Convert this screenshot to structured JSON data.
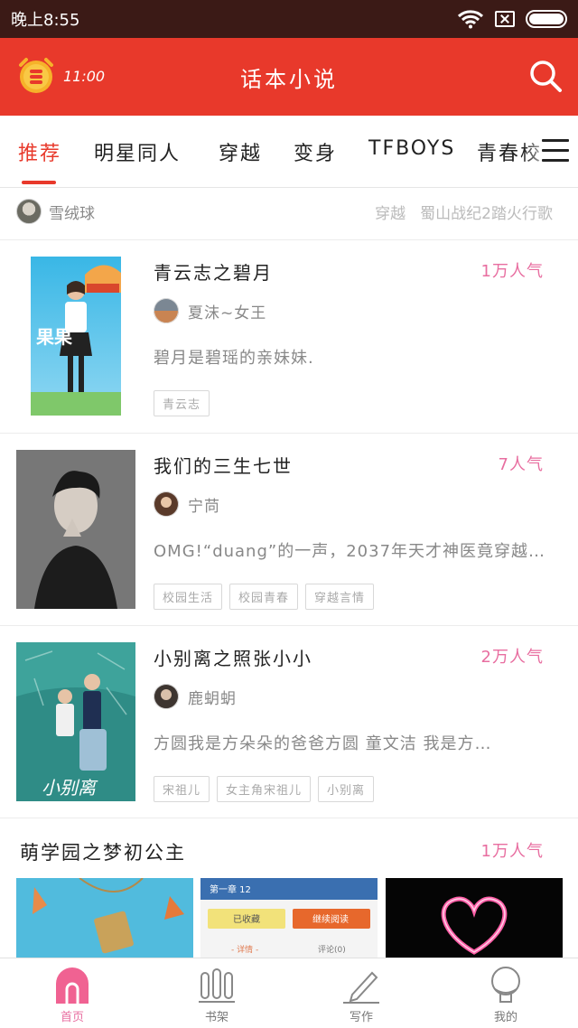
{
  "status_bar": {
    "time": "晚上8:55"
  },
  "app_bar": {
    "alarm_time": "11:00",
    "title": "话本小说"
  },
  "tabs": [
    {
      "label": "推荐",
      "active": true
    },
    {
      "label": "明星同人"
    },
    {
      "label": "穿越"
    },
    {
      "label": "变身"
    },
    {
      "label": "TFBOYS"
    },
    {
      "label": "青春校"
    }
  ],
  "ticker": {
    "user": "雪绒球",
    "category": "穿越",
    "book": "蜀山战纪2踏火行歌"
  },
  "books": [
    {
      "title": "青云志之碧月",
      "popularity": "1万人气",
      "author": "夏沫~女王",
      "description": "碧月是碧瑶的亲妹妹.",
      "tags": [
        "青云志"
      ],
      "cover_text": "果果"
    },
    {
      "title": "我们的三生七世",
      "popularity": "7人气",
      "author": "宁苘",
      "description": "OMG!“duang”的一声，2037年天才神医竟穿越…",
      "tags": [
        "校园生活",
        "校园青春",
        "穿越言情"
      ]
    },
    {
      "title": "小别离之照张小小",
      "popularity": "2万人气",
      "author": "鹿蚏蚏",
      "description": "方圆我是方朵朵的爸爸方圆 童文洁 我是方…",
      "tags": [
        "宋祖儿",
        "女主角宋祖儿",
        "小别离"
      ],
      "cover_text": "小别离"
    }
  ],
  "featured": {
    "title": "萌学园之梦初公主",
    "popularity": "1万人气",
    "thumb2": {
      "btn1": "已收藏",
      "btn2": "继续阅读",
      "link1": "- 详情 -",
      "link2": "评论(0)",
      "top": "第一章 12"
    }
  },
  "bottom_nav": [
    {
      "label": "首页",
      "icon": "home-icon",
      "active": true
    },
    {
      "label": "书架",
      "icon": "bookshelf-icon"
    },
    {
      "label": "写作",
      "icon": "pen-icon"
    },
    {
      "label": "我的",
      "icon": "profile-icon"
    }
  ],
  "colors": {
    "brand": "#e8392b",
    "popularity": "#e86ea0",
    "status_bar": "#3b1a16"
  }
}
